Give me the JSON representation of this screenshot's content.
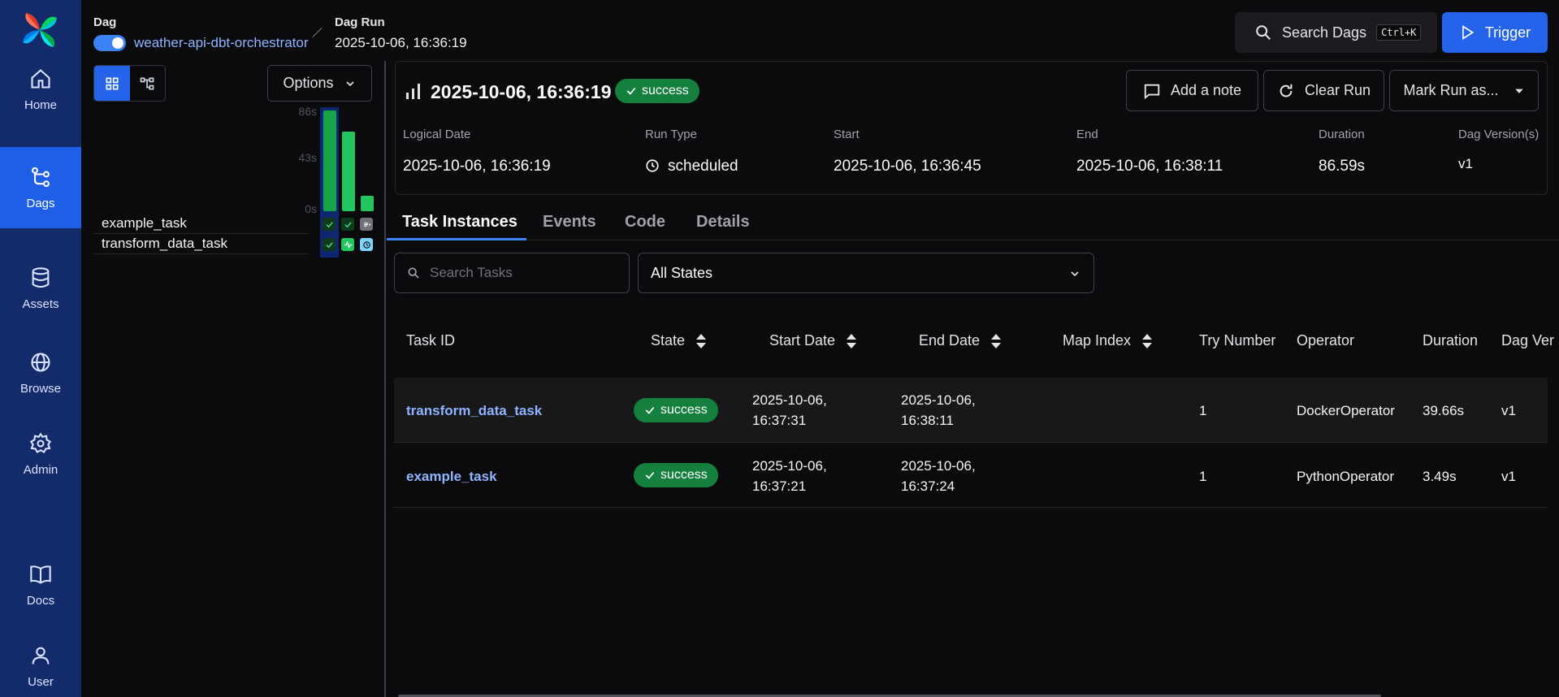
{
  "nav": {
    "items": [
      {
        "label": "Home"
      },
      {
        "label": "Dags"
      },
      {
        "label": "Assets"
      },
      {
        "label": "Browse"
      },
      {
        "label": "Admin"
      },
      {
        "label": "Docs"
      },
      {
        "label": "User"
      }
    ],
    "active": "Dags"
  },
  "header": {
    "dag_label": "Dag",
    "dag_name": "weather-api-dbt-orchestrator",
    "dag_run_label": "Dag Run",
    "dag_run_value": "2025-10-06, 16:36:19",
    "search_label": "Search Dags",
    "search_shortcut": "Ctrl+K",
    "trigger_label": "Trigger"
  },
  "grid": {
    "options_label": "Options",
    "ticks": [
      "86s",
      "43s",
      "0s"
    ],
    "run_durations": [
      86,
      68,
      13
    ],
    "max_duration": 86,
    "tasks": [
      "example_task",
      "transform_data_task"
    ]
  },
  "run": {
    "title": "2025-10-06, 16:36:19",
    "status": "success",
    "add_note": "Add a note",
    "clear_run": "Clear Run",
    "mark_run": "Mark Run as...",
    "meta": {
      "logical_date_label": "Logical Date",
      "logical_date": "2025-10-06, 16:36:19",
      "run_type_label": "Run Type",
      "run_type": "scheduled",
      "start_label": "Start",
      "start": "2025-10-06, 16:36:45",
      "end_label": "End",
      "end": "2025-10-06, 16:38:11",
      "duration_label": "Duration",
      "duration": "86.59s",
      "version_label": "Dag Version(s)",
      "version": "v1"
    }
  },
  "tabs": [
    {
      "label": "Task Instances"
    },
    {
      "label": "Events"
    },
    {
      "label": "Code"
    },
    {
      "label": "Details"
    }
  ],
  "filters": {
    "search_placeholder": "Search Tasks",
    "state_selected": "All States"
  },
  "table": {
    "headers": [
      "Task ID",
      "State",
      "Start Date",
      "End Date",
      "Map Index",
      "Try Number",
      "Operator",
      "Duration",
      "Dag Ver"
    ],
    "rows": [
      {
        "task_id": "transform_data_task",
        "state": "success",
        "start_1": "2025-10-06,",
        "start_2": "16:37:31",
        "end_1": "2025-10-06,",
        "end_2": "16:38:11",
        "try_number": "1",
        "operator": "DockerOperator",
        "duration": "39.66s",
        "version": "v1"
      },
      {
        "task_id": "example_task",
        "state": "success",
        "start_1": "2025-10-06,",
        "start_2": "16:37:21",
        "end_1": "2025-10-06,",
        "end_2": "16:37:24",
        "try_number": "1",
        "operator": "PythonOperator",
        "duration": "3.49s",
        "version": "v1"
      }
    ]
  },
  "colors": {
    "nav_bg": "#132a6b",
    "accent": "#2563eb",
    "success": "#15803d",
    "bar": "#22c55e"
  }
}
